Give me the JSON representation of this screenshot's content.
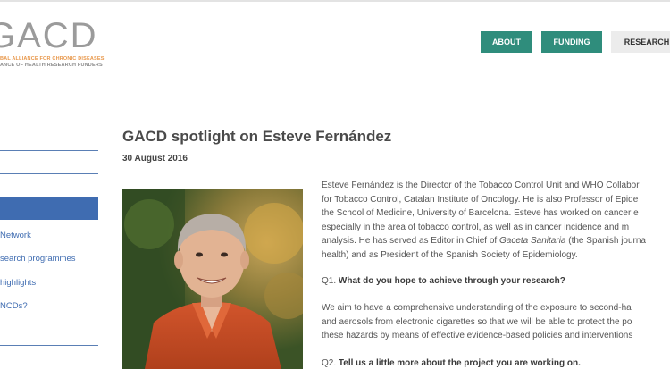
{
  "logo": {
    "mark": "GACD",
    "line1": "BAL ALLIANCE FOR CHRONIC DISEASES",
    "line2": "ANCE OF HEALTH RESEARCH FUNDERS"
  },
  "nav": {
    "about": "ABOUT",
    "funding": "FUNDING",
    "research": "RESEARCH"
  },
  "sidebar": {
    "items": [
      "Network",
      "search programmes",
      "highlights",
      "NCDs?"
    ]
  },
  "article": {
    "title": "GACD spotlight on Esteve Fernández",
    "date": "30 August 2016",
    "bio_lines": [
      "Esteve Fernández is the Director of the Tobacco Control Unit and WHO Collabor",
      "for Tobacco Control, Catalan Institute of Oncology. He is also Professor of Epide",
      "the School of Medicine, University of Barcelona. Esteve has worked on cancer e",
      "especially in the area of tobacco control, as well as in cancer incidence and m"
    ],
    "bio_line5_before": "analysis. He has served as Editor in Chief of ",
    "bio_line5_italic": "Gaceta Sanitaria",
    "bio_line5_after": " (the Spanish journa",
    "bio_line6": "health) and as President of the Spanish Society of Epidemiology.",
    "q1_prefix": "Q1. ",
    "q1_text": "What do you hope to achieve through your research?",
    "a1_lines": [
      "We aim to have a comprehensive understanding of the exposure to second-ha",
      "and aerosols from electronic cigarettes so that we will be able to protect the po",
      "these hazards by means of effective evidence-based policies and interventions"
    ],
    "q2_prefix": "Q2. ",
    "q2_text": "Tell us a little more about the project you are working on."
  },
  "colors": {
    "nav_active": "#2f8d7c",
    "sidebar_accent": "#3f6cb1",
    "logo_orange": "#e8974a"
  }
}
